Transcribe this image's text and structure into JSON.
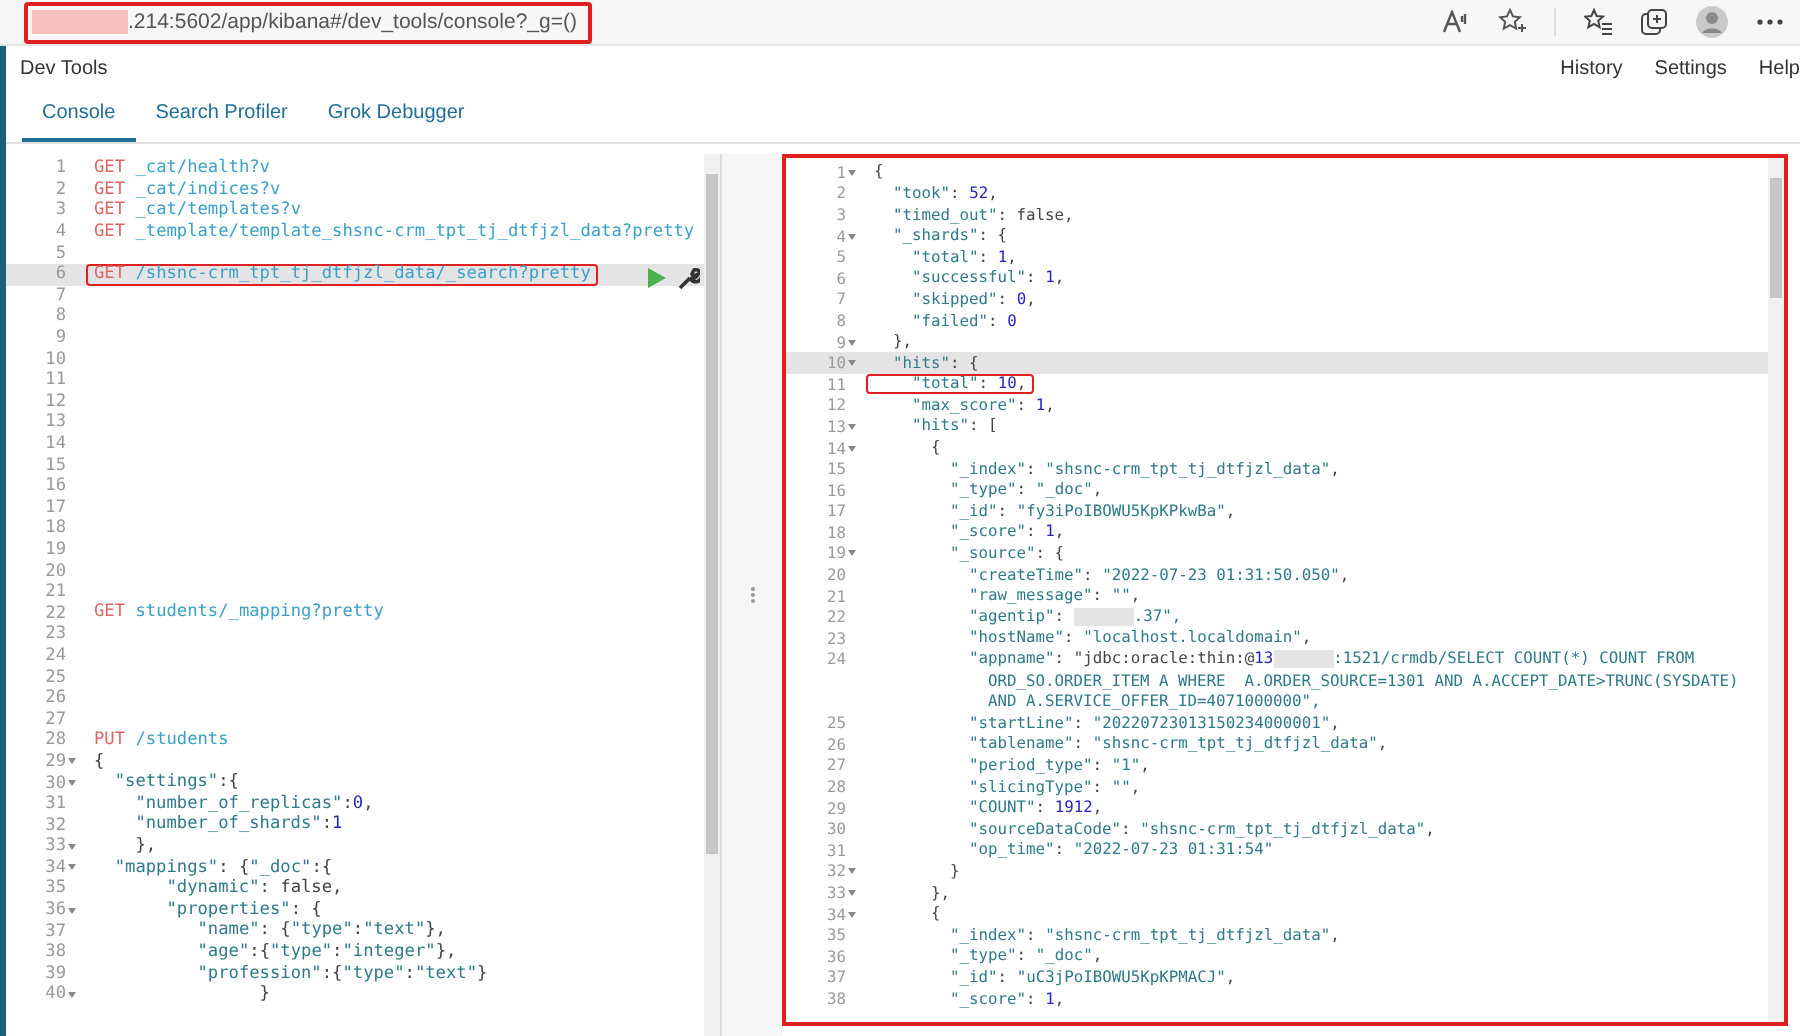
{
  "browser": {
    "url": ".214:5602/app/kibana#/dev_tools/console?_g=()",
    "url_highlighted": true
  },
  "app": {
    "title": "Dev Tools",
    "links": [
      "History",
      "Settings",
      "Help"
    ]
  },
  "tabs": [
    {
      "label": "Console",
      "selected": true
    },
    {
      "label": "Search Profiler",
      "selected": false
    },
    {
      "label": "Grok Debugger",
      "selected": false
    }
  ],
  "editor": {
    "lines": [
      {
        "n": "1",
        "method": "GET",
        "text": "_cat/health?v",
        "fold": false,
        "current": false,
        "boxed": false
      },
      {
        "n": "2",
        "method": "GET",
        "text": "_cat/indices?v",
        "fold": false,
        "current": false,
        "boxed": false
      },
      {
        "n": "3",
        "method": "GET",
        "text": "_cat/templates?v",
        "fold": false,
        "current": false,
        "boxed": false
      },
      {
        "n": "4",
        "method": "GET",
        "text": "_template/template_shsnc-crm_tpt_tj_dtfjzl_data?pretty",
        "fold": false,
        "current": false,
        "boxed": false
      },
      {
        "n": "5",
        "fold": false,
        "current": false,
        "boxed": false
      },
      {
        "n": "6",
        "method": "GET",
        "text": "/shsnc-crm_tpt_tj_dtfjzl_data/_search?pretty",
        "fold": false,
        "current": true,
        "boxed": true
      },
      {
        "n": "7",
        "fold": false,
        "current": false,
        "boxed": false
      },
      {
        "n": "8",
        "fold": false,
        "current": false,
        "boxed": false
      },
      {
        "n": "9",
        "fold": false,
        "current": false,
        "boxed": false
      },
      {
        "n": "10",
        "fold": false,
        "current": false,
        "boxed": false
      },
      {
        "n": "11",
        "fold": false,
        "current": false,
        "boxed": false
      },
      {
        "n": "12",
        "fold": false,
        "current": false,
        "boxed": false
      },
      {
        "n": "13",
        "fold": false,
        "current": false,
        "boxed": false
      },
      {
        "n": "14",
        "fold": false,
        "current": false,
        "boxed": false
      },
      {
        "n": "15",
        "fold": false,
        "current": false,
        "boxed": false
      },
      {
        "n": "16",
        "fold": false,
        "current": false,
        "boxed": false
      },
      {
        "n": "17",
        "fold": false,
        "current": false,
        "boxed": false
      },
      {
        "n": "18",
        "fold": false,
        "current": false,
        "boxed": false
      },
      {
        "n": "19",
        "fold": false,
        "current": false,
        "boxed": false
      },
      {
        "n": "20",
        "fold": false,
        "current": false,
        "boxed": false
      },
      {
        "n": "21",
        "fold": false,
        "current": false,
        "boxed": false
      },
      {
        "n": "22",
        "method": "GET",
        "text": "students/_mapping?pretty",
        "fold": false,
        "current": false,
        "boxed": false
      },
      {
        "n": "23",
        "fold": false,
        "current": false,
        "boxed": false
      },
      {
        "n": "24",
        "fold": false,
        "current": false,
        "boxed": false
      },
      {
        "n": "25",
        "fold": false,
        "current": false,
        "boxed": false
      },
      {
        "n": "26",
        "fold": false,
        "current": false,
        "boxed": false
      },
      {
        "n": "27",
        "fold": false,
        "current": false,
        "boxed": false
      },
      {
        "n": "28",
        "method": "PUT",
        "text": "/students",
        "fold": false,
        "current": false,
        "boxed": false
      },
      {
        "n": "29",
        "text": "{",
        "fold": true,
        "current": false,
        "boxed": false
      },
      {
        "n": "30",
        "text": "  \"settings\":{",
        "fold": true,
        "current": false,
        "boxed": false
      },
      {
        "n": "31",
        "text": "    \"number_of_replicas\":0,",
        "fold": false,
        "current": false,
        "boxed": false
      },
      {
        "n": "32",
        "text": "    \"number_of_shards\":1",
        "fold": false,
        "current": false,
        "boxed": false
      },
      {
        "n": "33",
        "text": "    },",
        "fold": true,
        "current": false,
        "boxed": false
      },
      {
        "n": "34",
        "text": "  \"mappings\": {\"_doc\":{",
        "fold": true,
        "current": false,
        "boxed": false
      },
      {
        "n": "35",
        "text": "       \"dynamic\": false,",
        "fold": false,
        "current": false,
        "boxed": false
      },
      {
        "n": "36",
        "text": "       \"properties\": {",
        "fold": true,
        "current": false,
        "boxed": false
      },
      {
        "n": "37",
        "text": "          \"name\": {\"type\":\"text\"},",
        "fold": false,
        "current": false,
        "boxed": false
      },
      {
        "n": "38",
        "text": "          \"age\":{\"type\":\"integer\"},",
        "fold": false,
        "current": false,
        "boxed": false
      },
      {
        "n": "39",
        "text": "          \"profession\":{\"type\":\"text\"}",
        "fold": false,
        "current": false,
        "boxed": false
      },
      {
        "n": "40",
        "text": "                }",
        "fold": true,
        "current": false,
        "boxed": false
      }
    ]
  },
  "output": {
    "highlighted": true,
    "lines": [
      {
        "n": "1",
        "text": "{",
        "fold": true,
        "current": false,
        "boxed": false
      },
      {
        "n": "2",
        "text": "  \"took\": 52,",
        "fold": false,
        "current": false,
        "boxed": false
      },
      {
        "n": "3",
        "text": "  \"timed_out\": false,",
        "fold": false,
        "current": false,
        "boxed": false
      },
      {
        "n": "4",
        "text": "  \"_shards\": {",
        "fold": true,
        "current": false,
        "boxed": false
      },
      {
        "n": "5",
        "text": "    \"total\": 1,",
        "fold": false,
        "current": false,
        "boxed": false
      },
      {
        "n": "6",
        "text": "    \"successful\": 1,",
        "fold": false,
        "current": false,
        "boxed": false
      },
      {
        "n": "7",
        "text": "    \"skipped\": 0,",
        "fold": false,
        "current": false,
        "boxed": false
      },
      {
        "n": "8",
        "text": "    \"failed\": 0",
        "fold": false,
        "current": false,
        "boxed": false
      },
      {
        "n": "9",
        "text": "  },",
        "fold": true,
        "current": false,
        "boxed": false
      },
      {
        "n": "10",
        "text": "  \"hits\": {",
        "fold": true,
        "current": true,
        "boxed": false
      },
      {
        "n": "11",
        "text": "    \"total\": 10,",
        "fold": false,
        "current": false,
        "boxed": true
      },
      {
        "n": "12",
        "text": "    \"max_score\": 1,",
        "fold": false,
        "current": false,
        "boxed": false
      },
      {
        "n": "13",
        "text": "    \"hits\": [",
        "fold": true,
        "current": false,
        "boxed": false
      },
      {
        "n": "14",
        "text": "      {",
        "fold": true,
        "current": false,
        "boxed": false
      },
      {
        "n": "15",
        "text": "        \"_index\": \"shsnc-crm_tpt_tj_dtfjzl_data\",",
        "fold": false,
        "current": false,
        "boxed": false
      },
      {
        "n": "16",
        "text": "        \"_type\": \"_doc\",",
        "fold": false,
        "current": false,
        "boxed": false
      },
      {
        "n": "17",
        "text": "        \"_id\": \"fy3iPoIBOWU5KpKPkwBa\",",
        "fold": false,
        "current": false,
        "boxed": false
      },
      {
        "n": "18",
        "text": "        \"_score\": 1,",
        "fold": false,
        "current": false,
        "boxed": false
      },
      {
        "n": "19",
        "text": "        \"_source\": {",
        "fold": true,
        "current": false,
        "boxed": false
      },
      {
        "n": "20",
        "text": "          \"createTime\": \"2022-07-23 01:31:50.050\",",
        "fold": false,
        "current": false,
        "boxed": false
      },
      {
        "n": "21",
        "text": "          \"raw_message\": \"\",",
        "fold": false,
        "current": false,
        "boxed": false
      },
      {
        "n": "22",
        "text": "          \"agentip\": ",
        "after": ".37\",",
        "fold": false,
        "current": false,
        "boxed": false
      },
      {
        "n": "23",
        "text": "          \"hostName\": \"localhost.localdomain\",",
        "fold": false,
        "current": false,
        "boxed": false
      },
      {
        "n": "24",
        "text": "          \"appname\": \"jdbc:oracle:thin:@13",
        "after": ":1521/crmdb/SELECT COUNT(*) COUNT FROM",
        "cont": [
          "            ORD_SO.ORDER_ITEM A WHERE  A.ORDER_SOURCE=1301 AND A.ACCEPT_DATE>TRUNC(SYSDATE)",
          "            AND A.SERVICE_OFFER_ID=4071000000\","
        ],
        "fold": false,
        "current": false,
        "boxed": false
      },
      {
        "n": "25",
        "text": "          \"startLine\": \"20220723013150234000001\",",
        "fold": false,
        "current": false,
        "boxed": false
      },
      {
        "n": "26",
        "text": "          \"tablename\": \"shsnc-crm_tpt_tj_dtfjzl_data\",",
        "fold": false,
        "current": false,
        "boxed": false
      },
      {
        "n": "27",
        "text": "          \"period_type\": \"1\",",
        "fold": false,
        "current": false,
        "boxed": false
      },
      {
        "n": "28",
        "text": "          \"slicingType\": \"\",",
        "fold": false,
        "current": false,
        "boxed": false
      },
      {
        "n": "29",
        "text": "          \"COUNT\": 1912,",
        "fold": false,
        "current": false,
        "boxed": false
      },
      {
        "n": "30",
        "text": "          \"sourceDataCode\": \"shsnc-crm_tpt_tj_dtfjzl_data\",",
        "fold": false,
        "current": false,
        "boxed": false
      },
      {
        "n": "31",
        "text": "          \"op_time\": \"2022-07-23 01:31:54\"",
        "fold": false,
        "current": false,
        "boxed": false
      },
      {
        "n": "32",
        "text": "        }",
        "fold": true,
        "current": false,
        "boxed": false
      },
      {
        "n": "33",
        "text": "      },",
        "fold": true,
        "current": false,
        "boxed": false
      },
      {
        "n": "34",
        "text": "      {",
        "fold": true,
        "current": false,
        "boxed": false
      },
      {
        "n": "35",
        "text": "        \"_index\": \"shsnc-crm_tpt_tj_dtfjzl_data\",",
        "fold": false,
        "current": false,
        "boxed": false
      },
      {
        "n": "36",
        "text": "        \"_type\": \"_doc\",",
        "fold": false,
        "current": false,
        "boxed": false
      },
      {
        "n": "37",
        "text": "        \"_id\": \"uC3jPoIBOWU5KpKPMACJ\",",
        "fold": false,
        "current": false,
        "boxed": false
      },
      {
        "n": "38",
        "text": "        \"_score\": 1,",
        "fold": false,
        "current": false,
        "boxed": false
      }
    ]
  }
}
